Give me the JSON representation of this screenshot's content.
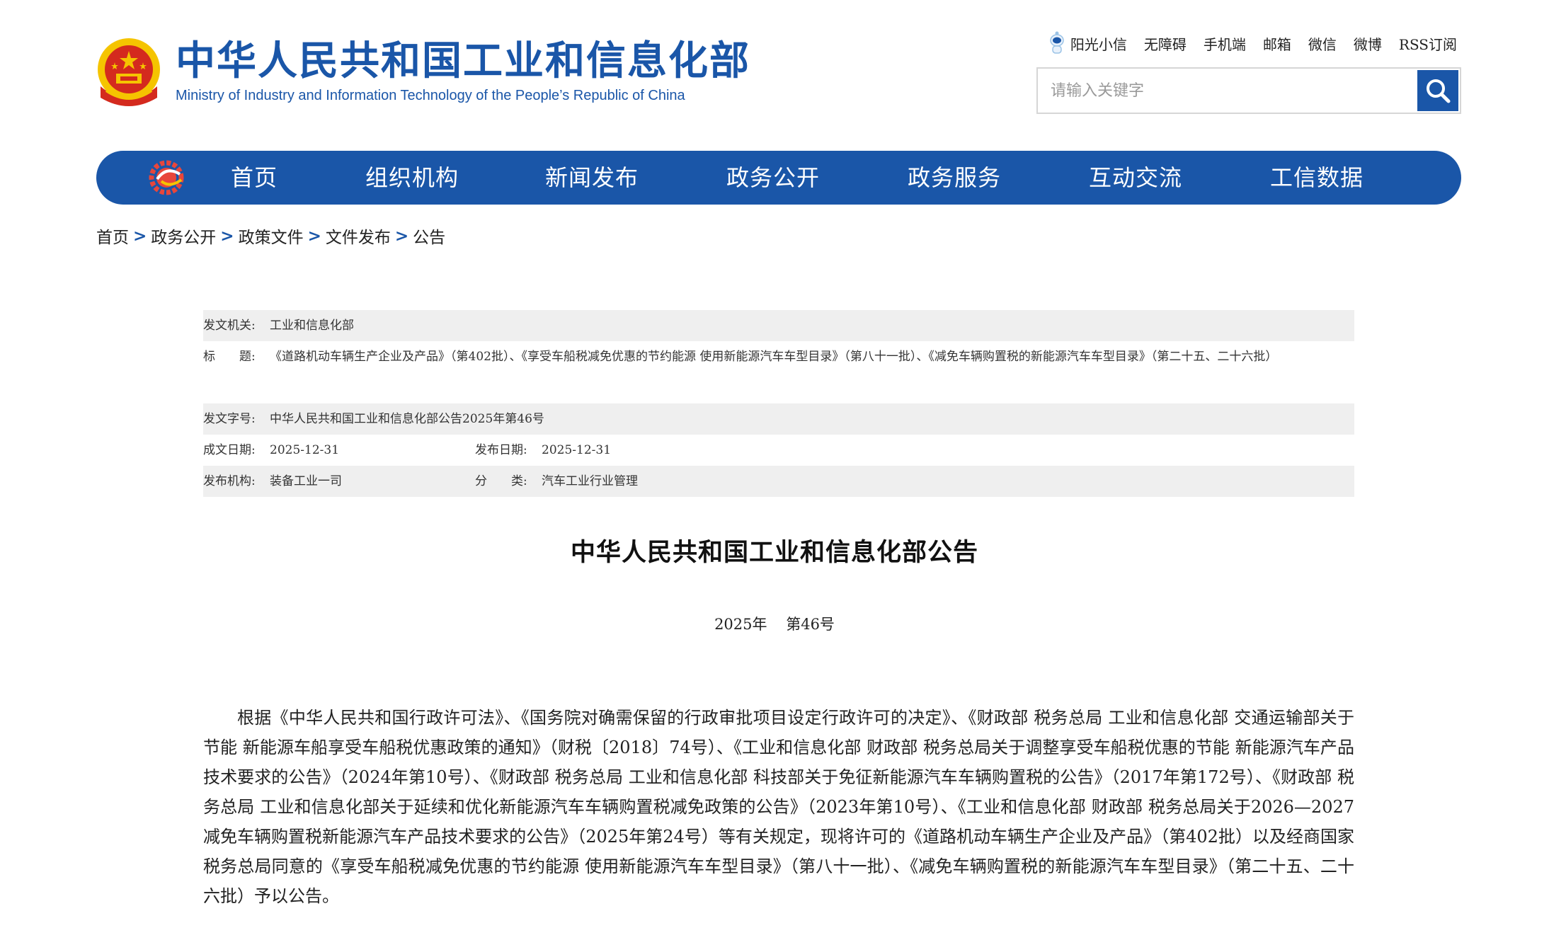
{
  "header": {
    "logo_cn": "中华人民共和国工业和信息化部",
    "logo_en": "Ministry of Industry and Information Technology of the People’s Republic of China",
    "top_links": [
      "阳光小信",
      "无障碍",
      "手机端",
      "邮箱",
      "微信",
      "微博",
      "RSS订阅"
    ],
    "search_placeholder": "请输入关键字",
    "icons": {
      "search": "search-icon",
      "assistant": "robot-icon",
      "emblem": "national-emblem-icon"
    }
  },
  "nav": {
    "items": [
      "首页",
      "组织机构",
      "新闻发布",
      "政务公开",
      "政务服务",
      "互动交流",
      "工信数据"
    ]
  },
  "breadcrumb": [
    "首页",
    "政务公开",
    "政策文件",
    "文件发布",
    "公告"
  ],
  "breadcrumb_sep": ">",
  "meta": {
    "issuer_label": "发文机关:",
    "issuer": "工业和信息化部",
    "title_label": "标　　题:",
    "title": "《道路机动车辆生产企业及产品》（第402批）、《享受车船税减免优惠的节约能源 使用新能源汽车车型目录》（第八十一批）、《减免车辆购置税的新能源汽车车型目录》（第二十五、二十六批）",
    "docno_label": "发文字号:",
    "docno": "中华人民共和国工业和信息化部公告2025年第46号",
    "written_label": "成文日期:",
    "written": "2025-12-31",
    "published_label": "发布日期:",
    "published": "2025-12-31",
    "org_label": "发布机构:",
    "org": "装备工业一司",
    "category_label": "分　　类:",
    "category": "汽车工业行业管理"
  },
  "document": {
    "title": "中华人民共和国工业和信息化部公告",
    "year": "2025年",
    "number": "第46号",
    "body": "根据《中华人民共和国行政许可法》、《国务院对确需保留的行政审批项目设定行政许可的决定》、《财政部 税务总局 工业和信息化部 交通运输部关于节能 新能源车船享受车船税优惠政策的通知》（财税〔2018〕74号）、《工业和信息化部 财政部 税务总局关于调整享受车船税优惠的节能 新能源汽车产品技术要求的公告》（2024年第10号）、《财政部 税务总局 工业和信息化部 科技部关于免征新能源汽车车辆购置税的公告》（2017年第172号）、《财政部 税务总局 工业和信息化部关于延续和优化新能源汽车车辆购置税减免政策的公告》（2023年第10号）、《工业和信息化部 财政部 税务总局关于2026—2027减免车辆购置税新能源汽车产品技术要求的公告》（2025年第24号）等有关规定，现将许可的《道路机动车辆生产企业及产品》（第402批）以及经商国家税务总局同意的《享受车船税减免优惠的节约能源 使用新能源汽车车型目录》（第八十一批）、《减免车辆购置税的新能源汽车车型目录》（第二十五、二十六批）予以公告。"
  },
  "colors": {
    "brand_blue": "#1a56a8",
    "meta_shade": "#efefef",
    "emblem_red": "#d42a1e",
    "emblem_gold": "#f5c400"
  }
}
